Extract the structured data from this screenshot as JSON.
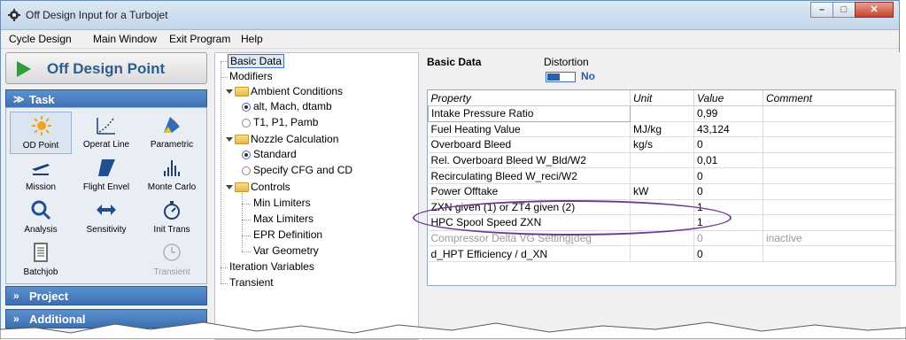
{
  "window": {
    "title": "Off Design Input for a Turbojet",
    "icon": "app-gear-icon"
  },
  "menu": [
    "Cycle Design",
    "Main Window",
    "Exit Program",
    "Help"
  ],
  "left_panel": {
    "run_button": "Off Design Point",
    "task_section": "Task",
    "tasks": [
      {
        "label": "OD Point",
        "icon": "sun-icon",
        "selected": true,
        "enabled": true
      },
      {
        "label": "Operat Line",
        "icon": "operating-line-icon",
        "selected": false,
        "enabled": true
      },
      {
        "label": "Parametric",
        "icon": "parametric-icon",
        "selected": false,
        "enabled": true
      },
      {
        "label": "Mission",
        "icon": "airplane-icon",
        "selected": false,
        "enabled": true
      },
      {
        "label": "Flight Envel",
        "icon": "flight-envelope-icon",
        "selected": false,
        "enabled": true
      },
      {
        "label": "Monte Carlo",
        "icon": "bar-chart-icon",
        "selected": false,
        "enabled": true
      },
      {
        "label": "Analysis",
        "icon": "magnifier-icon",
        "selected": false,
        "enabled": true
      },
      {
        "label": "Sensitivity",
        "icon": "double-arrow-icon",
        "selected": false,
        "enabled": true
      },
      {
        "label": "Init Trans",
        "icon": "stopwatch-icon",
        "selected": false,
        "enabled": true
      },
      {
        "label": "Batchjob",
        "icon": "document-icon",
        "selected": false,
        "enabled": true
      },
      {
        "label": "Transient",
        "icon": "clock-icon",
        "selected": false,
        "enabled": false
      }
    ],
    "project_section": "Project",
    "additional_section": "Additional"
  },
  "tree": {
    "basic_data": "Basic Data",
    "modifiers": "Modifiers",
    "ambient": "Ambient Conditions",
    "ambient_opt1": "alt, Mach, dtamb",
    "ambient_opt2": "T1, P1, Pamb",
    "nozzle": "Nozzle Calculation",
    "nozzle_opt1": "Standard",
    "nozzle_opt2": "Specify CFG and CD",
    "controls": "Controls",
    "min_limiters": "Min Limiters",
    "max_limiters": "Max Limiters",
    "epr_def": "EPR Definition",
    "var_geometry": "Var Geometry",
    "iteration_vars": "Iteration Variables",
    "transient": "Transient"
  },
  "basic_data": {
    "title": "Basic Data",
    "distortion_label": "Distortion",
    "distortion_value": "No",
    "columns": [
      "Property",
      "Unit",
      "Value",
      "Comment"
    ],
    "rows": [
      {
        "property": "Intake Pressure Ratio",
        "unit": "",
        "value": "0,99",
        "comment": "",
        "dim": false
      },
      {
        "property": "Fuel Heating Value",
        "unit": "MJ/kg",
        "value": "43,124",
        "comment": "",
        "dim": false
      },
      {
        "property": "Overboard Bleed",
        "unit": "kg/s",
        "value": "0",
        "comment": "",
        "dim": false
      },
      {
        "property": "Rel. Overboard Bleed W_Bld/W2",
        "unit": "",
        "value": "0,01",
        "comment": "",
        "dim": false
      },
      {
        "property": "Recirculating Bleed W_reci/W2",
        "unit": "",
        "value": "0",
        "comment": "",
        "dim": false
      },
      {
        "property": "Power Offtake",
        "unit": "kW",
        "value": "0",
        "comment": "",
        "dim": false
      },
      {
        "property": "ZXN given (1) or ZT4 given (2)",
        "unit": "",
        "value": "1",
        "comment": "",
        "dim": false
      },
      {
        "property": "HPC Spool Speed ZXN",
        "unit": "",
        "value": "1",
        "comment": "",
        "dim": false
      },
      {
        "property": "Compressor Delta VG Setting[deg",
        "unit": "",
        "value": "0",
        "comment": "inactive",
        "dim": true
      },
      {
        "property": "d_HPT Efficiency / d_XN",
        "unit": "",
        "value": "0",
        "comment": "",
        "dim": false
      }
    ]
  },
  "colors": {
    "accent": "#3c6fb0",
    "highlight_ellipse": "#6e3b8f",
    "run_icon": "#2e9e3a"
  }
}
